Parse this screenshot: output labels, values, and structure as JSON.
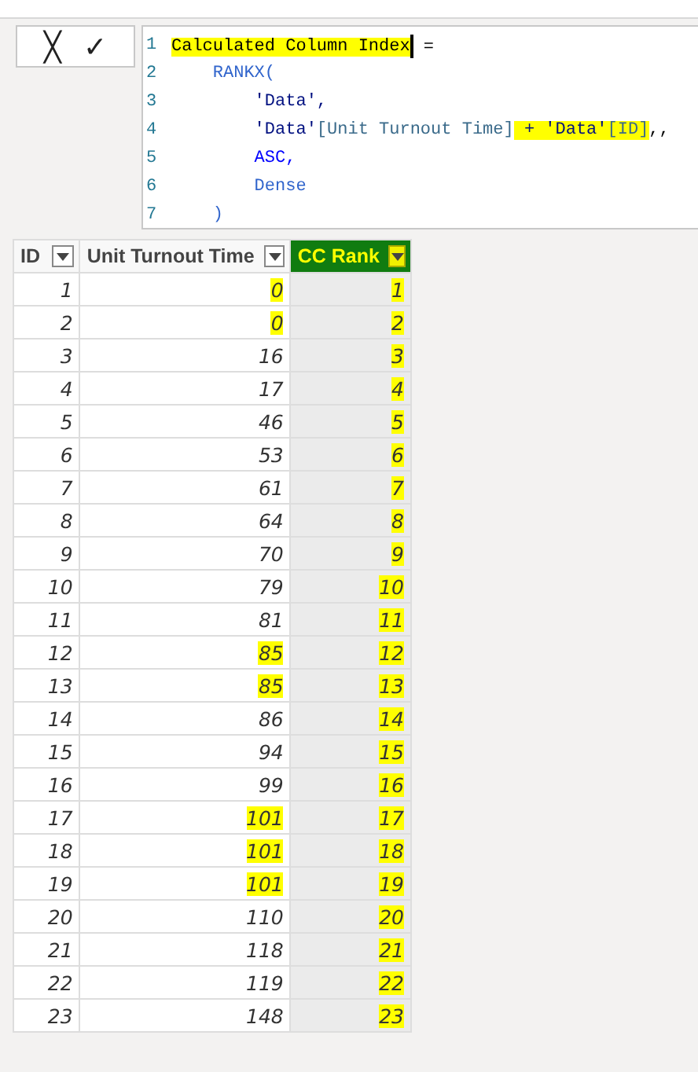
{
  "formula_bar": {
    "cancel": "╳",
    "commit": "✓",
    "lines": [
      {
        "number": "1",
        "segments": [
          {
            "text": "Calculated Column Index",
            "kind": "plain",
            "highlighted": true,
            "caret": true
          },
          {
            "text": " =",
            "kind": "plain",
            "highlighted": false,
            "caret": false
          }
        ]
      },
      {
        "number": "2",
        "segments": [
          {
            "text": "    RANKX(",
            "kind": "function",
            "highlighted": false,
            "caret": false
          }
        ]
      },
      {
        "number": "3",
        "segments": [
          {
            "text": "        'Data',",
            "kind": "table",
            "highlighted": false,
            "caret": false
          }
        ]
      },
      {
        "number": "4",
        "segments": [
          {
            "text": "        'Data'",
            "kind": "table",
            "highlighted": false,
            "caret": false
          },
          {
            "text": "[Unit Turnout Time]",
            "kind": "column",
            "highlighted": false,
            "caret": false
          },
          {
            "text": " + 'Data'",
            "kind": "table",
            "highlighted": true,
            "caret": false
          },
          {
            "text": "[ID]",
            "kind": "column",
            "highlighted": true,
            "caret": false
          },
          {
            "text": ",,",
            "kind": "plain",
            "highlighted": false,
            "caret": false
          }
        ]
      },
      {
        "number": "5",
        "segments": [
          {
            "text": "        ASC,",
            "kind": "keyword",
            "highlighted": false,
            "caret": false
          }
        ]
      },
      {
        "number": "6",
        "segments": [
          {
            "text": "        Dense",
            "kind": "function",
            "highlighted": false,
            "caret": false
          }
        ]
      },
      {
        "number": "7",
        "segments": [
          {
            "text": "    )",
            "kind": "function",
            "highlighted": false,
            "caret": false
          }
        ]
      }
    ]
  },
  "table": {
    "columns": [
      {
        "label": "ID",
        "selected": false,
        "highlighted": false
      },
      {
        "label": "Unit Turnout Time",
        "selected": false,
        "highlighted": false
      },
      {
        "label": "CC Rank",
        "selected": true,
        "highlighted": true
      }
    ],
    "rows": [
      {
        "id": "1",
        "time": "0",
        "rank": "1",
        "time_highlighted": true,
        "rank_highlighted": true
      },
      {
        "id": "2",
        "time": "0",
        "rank": "2",
        "time_highlighted": true,
        "rank_highlighted": true
      },
      {
        "id": "3",
        "time": "16",
        "rank": "3",
        "time_highlighted": false,
        "rank_highlighted": true
      },
      {
        "id": "4",
        "time": "17",
        "rank": "4",
        "time_highlighted": false,
        "rank_highlighted": true
      },
      {
        "id": "5",
        "time": "46",
        "rank": "5",
        "time_highlighted": false,
        "rank_highlighted": true
      },
      {
        "id": "6",
        "time": "53",
        "rank": "6",
        "time_highlighted": false,
        "rank_highlighted": true
      },
      {
        "id": "7",
        "time": "61",
        "rank": "7",
        "time_highlighted": false,
        "rank_highlighted": true
      },
      {
        "id": "8",
        "time": "64",
        "rank": "8",
        "time_highlighted": false,
        "rank_highlighted": true
      },
      {
        "id": "9",
        "time": "70",
        "rank": "9",
        "time_highlighted": false,
        "rank_highlighted": true
      },
      {
        "id": "10",
        "time": "79",
        "rank": "10",
        "time_highlighted": false,
        "rank_highlighted": true
      },
      {
        "id": "11",
        "time": "81",
        "rank": "11",
        "time_highlighted": false,
        "rank_highlighted": true
      },
      {
        "id": "12",
        "time": "85",
        "rank": "12",
        "time_highlighted": true,
        "rank_highlighted": true
      },
      {
        "id": "13",
        "time": "85",
        "rank": "13",
        "time_highlighted": true,
        "rank_highlighted": true
      },
      {
        "id": "14",
        "time": "86",
        "rank": "14",
        "time_highlighted": false,
        "rank_highlighted": true
      },
      {
        "id": "15",
        "time": "94",
        "rank": "15",
        "time_highlighted": false,
        "rank_highlighted": true
      },
      {
        "id": "16",
        "time": "99",
        "rank": "16",
        "time_highlighted": false,
        "rank_highlighted": true
      },
      {
        "id": "17",
        "time": "101",
        "rank": "17",
        "time_highlighted": true,
        "rank_highlighted": true
      },
      {
        "id": "18",
        "time": "101",
        "rank": "18",
        "time_highlighted": true,
        "rank_highlighted": true
      },
      {
        "id": "19",
        "time": "101",
        "rank": "19",
        "time_highlighted": true,
        "rank_highlighted": true
      },
      {
        "id": "20",
        "time": "110",
        "rank": "20",
        "time_highlighted": false,
        "rank_highlighted": true
      },
      {
        "id": "21",
        "time": "118",
        "rank": "21",
        "time_highlighted": false,
        "rank_highlighted": true
      },
      {
        "id": "22",
        "time": "119",
        "rank": "22",
        "time_highlighted": false,
        "rank_highlighted": true
      },
      {
        "id": "23",
        "time": "148",
        "rank": "23",
        "time_highlighted": false,
        "rank_highlighted": true
      }
    ]
  }
}
